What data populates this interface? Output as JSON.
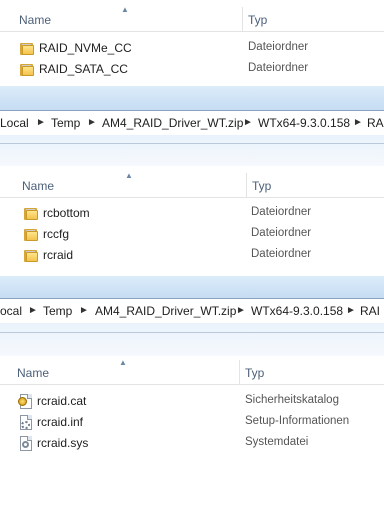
{
  "pane1": {
    "col_name": "Name",
    "col_type": "Typ",
    "rows": [
      {
        "name": "RAID_NVMe_CC",
        "type": "Dateiordner",
        "icon": "folder-icon"
      },
      {
        "name": "RAID_SATA_CC",
        "type": "Dateiordner",
        "icon": "folder-icon"
      }
    ]
  },
  "address1": {
    "segments": [
      "Local",
      "Temp",
      "AM4_RAID_Driver_WT.zip",
      "WTx64-9.3.0.158",
      "RAI"
    ]
  },
  "pane2": {
    "col_name": "Name",
    "col_type": "Typ",
    "rows": [
      {
        "name": "rcbottom",
        "type": "Dateiordner",
        "icon": "folder-icon"
      },
      {
        "name": "rccfg",
        "type": "Dateiordner",
        "icon": "folder-icon"
      },
      {
        "name": "rcraid",
        "type": "Dateiordner",
        "icon": "folder-icon"
      }
    ]
  },
  "address2": {
    "segments": [
      "ocal",
      "Temp",
      "AM4_RAID_Driver_WT.zip",
      "WTx64-9.3.0.158",
      "RAI"
    ]
  },
  "pane3": {
    "col_name": "Name",
    "col_type": "Typ",
    "rows": [
      {
        "name": "rcraid.cat",
        "type": "Sicherheitskatalog",
        "icon": "security-catalog-icon"
      },
      {
        "name": "rcraid.inf",
        "type": "Setup-Informationen",
        "icon": "setup-info-icon"
      },
      {
        "name": "rcraid.sys",
        "type": "Systemdatei",
        "icon": "system-file-icon"
      }
    ]
  },
  "colors": {
    "header_text": "#4c607a",
    "band_top": "#dcecfa",
    "band_bottom": "#c5dcf2",
    "folder": "#f3c44d"
  }
}
